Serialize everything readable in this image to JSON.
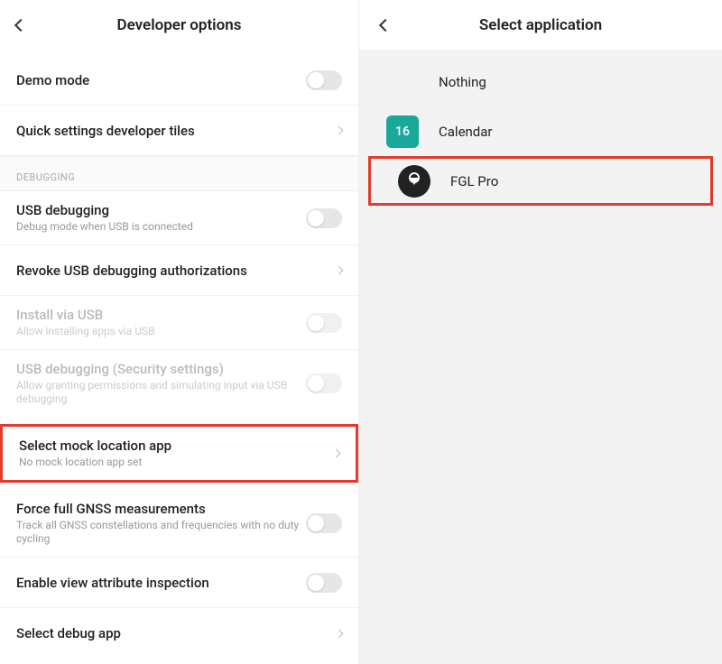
{
  "left": {
    "title": "Developer options",
    "rows": {
      "demo": {
        "title": "Demo mode"
      },
      "tiles": {
        "title": "Quick settings developer tiles"
      },
      "section": "DEBUGGING",
      "usb": {
        "title": "USB debugging",
        "sub": "Debug mode when USB is connected"
      },
      "revoke": {
        "title": "Revoke USB debugging authorizations"
      },
      "install": {
        "title": "Install via USB",
        "sub": "Allow installing apps via USB"
      },
      "usbsec": {
        "title": "USB debugging (Security settings)",
        "sub": "Allow granting permissions and simulating input via USB debugging"
      },
      "mock": {
        "title": "Select mock location app",
        "sub": "No mock location app set"
      },
      "gnss": {
        "title": "Force full GNSS measurements",
        "sub": "Track all GNSS constellations and frequencies with no duty cycling"
      },
      "viewattr": {
        "title": "Enable view attribute inspection"
      },
      "debugapp": {
        "title": "Select debug app"
      }
    }
  },
  "right": {
    "title": "Select application",
    "apps": {
      "nothing": "Nothing",
      "calendar": {
        "name": "Calendar",
        "badge": "16"
      },
      "fgl": {
        "name": "FGL Pro"
      }
    }
  }
}
